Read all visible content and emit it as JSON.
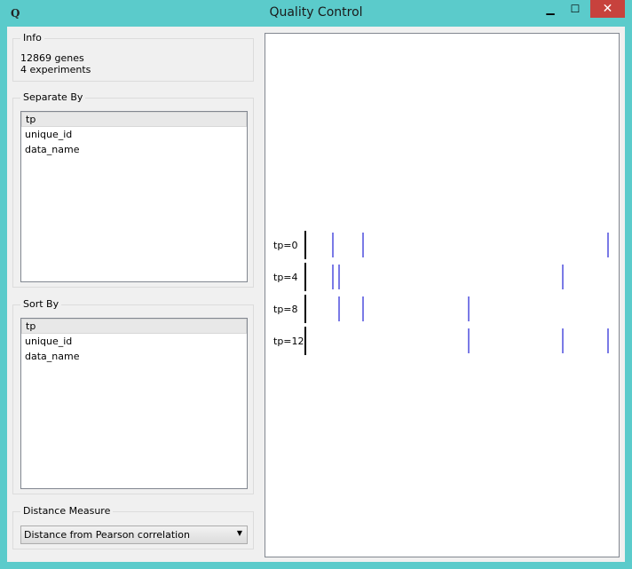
{
  "window": {
    "title": "Quality Control",
    "app_icon": "Q",
    "minimize": "▁",
    "maximize": "☐",
    "close": "✕"
  },
  "info": {
    "title": "Info",
    "genes": "12869 genes",
    "experiments": "4 experiments"
  },
  "separate_by": {
    "title": "Separate By",
    "items": [
      "tp",
      "unique_id",
      "data_name"
    ],
    "selected": "tp"
  },
  "sort_by": {
    "title": "Sort By",
    "items": [
      "tp",
      "unique_id",
      "data_name"
    ],
    "selected": "tp"
  },
  "distance": {
    "title": "Distance Measure",
    "value": "Distance from Pearson correlation"
  },
  "plot": {
    "rows": [
      {
        "label": "tp=0",
        "marks": [
          0.085,
          0.185,
          0.995
        ]
      },
      {
        "label": "tp=4",
        "marks": [
          0.085,
          0.105,
          0.845
        ]
      },
      {
        "label": "tp=8",
        "marks": [
          0.105,
          0.185,
          0.535
        ]
      },
      {
        "label": "tp=12",
        "marks": [
          0.535,
          0.845,
          0.995
        ]
      }
    ],
    "mark_color": "#7a7ae6"
  }
}
